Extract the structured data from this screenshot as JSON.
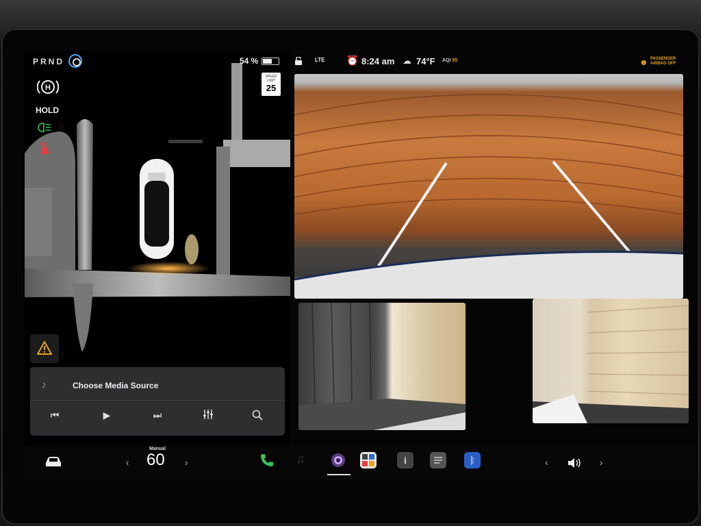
{
  "gear": {
    "selector": "PRND"
  },
  "battery": {
    "percent_label": "54 %",
    "level": 0.54
  },
  "speed_limit": {
    "label": "SPEED LIMIT",
    "value": "25"
  },
  "left_panel": {
    "hold_label": "HOLD"
  },
  "status_bar": {
    "network": "LTE",
    "time": "8:24 am",
    "temperature": "74°F",
    "aqi_label": "AQI",
    "aqi_value": "55",
    "airbag_line1": "PASSENGER",
    "airbag_line2": "AIRBAG OFF"
  },
  "media": {
    "title": "Choose Media Source"
  },
  "dock": {
    "mode_label": "Manual",
    "speed_setting": "60"
  },
  "icons": {
    "hold": "auto-hold-icon",
    "lights": "headlights-icon",
    "seatbelt": "seatbelt-warning-icon",
    "warning": "warning-icon",
    "steering": "steering-wheel-icon",
    "lock": "lock-icon",
    "alarm": "alarm-icon",
    "weather": "cloud-icon",
    "car": "car-icon",
    "phone": "phone-icon",
    "camera": "camera-icon",
    "fan": "fan-icon",
    "info": "info-icon",
    "notes": "notes-icon",
    "bluetooth": "bluetooth-icon",
    "volume": "volume-icon"
  },
  "colors": {
    "accent_blue": "#4aa3ff",
    "warning_amber": "#e6a31c",
    "lights_green": "#39c35a",
    "alert_red": "#e24040"
  }
}
